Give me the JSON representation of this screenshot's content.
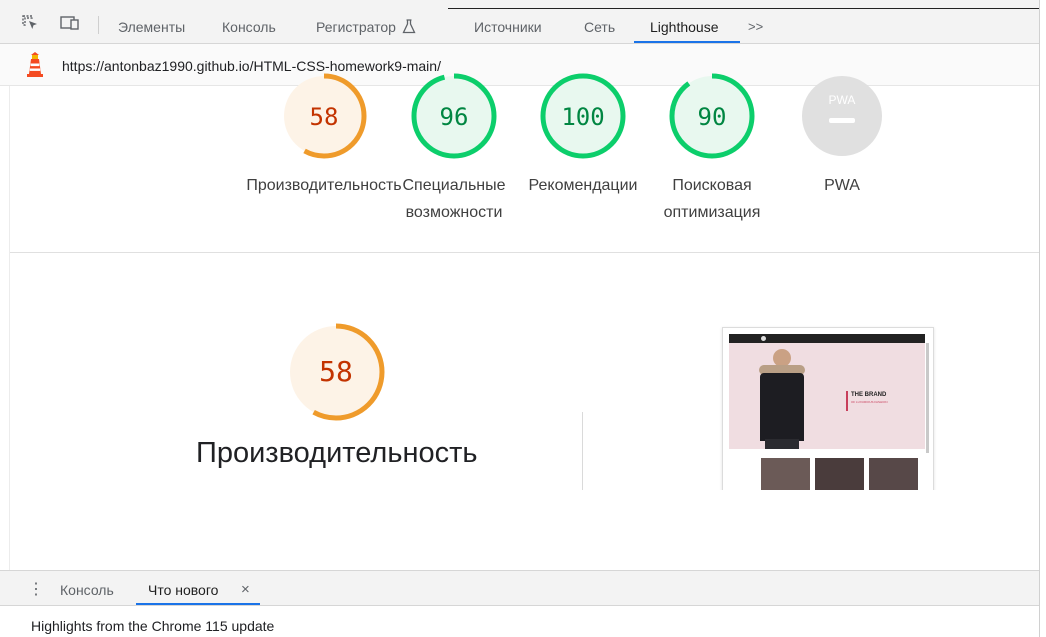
{
  "devtools": {
    "tabs": [
      {
        "label": "Элементы"
      },
      {
        "label": "Консоль"
      },
      {
        "label": "Регистратор"
      },
      {
        "label": "Источники"
      },
      {
        "label": "Сеть"
      },
      {
        "label": "Lighthouse",
        "active": true
      }
    ],
    "overflow_label": ">>"
  },
  "report": {
    "url": "https://antonbaz1990.github.io/HTML-CSS-homework9-main/",
    "categories": [
      {
        "score": "58",
        "label_lines": [
          "Производительность"
        ],
        "rating": "average",
        "fraction": 0.58
      },
      {
        "score": "96",
        "label_lines": [
          "Специальные",
          "возможности"
        ],
        "rating": "pass",
        "fraction": 0.96
      },
      {
        "score": "100",
        "label_lines": [
          "Рекомендации"
        ],
        "rating": "pass",
        "fraction": 1.0
      },
      {
        "score": "90",
        "label_lines": [
          "Поисковая",
          "оптимизация"
        ],
        "rating": "pass",
        "fraction": 0.9
      },
      {
        "score": "",
        "badge": "PWA",
        "label_lines": [
          "PWA"
        ],
        "rating": "na",
        "fraction": 0
      }
    ],
    "perf": {
      "score": "58",
      "title": "Производительность",
      "fraction": 0.58
    },
    "screenshot": {
      "brand_title": "THE BRAND",
      "brand_sub": "OF LUXURIOUS FASHION"
    }
  },
  "drawer": {
    "tabs": [
      {
        "label": "Консоль"
      },
      {
        "label": "Что нового",
        "active": true
      }
    ],
    "close_glyph": "×",
    "content": "Highlights from the Chrome 115 update"
  },
  "colors": {
    "average": "#ef9b2b",
    "average_bg": "#fdf3e7",
    "average_text": "#c33300",
    "pass": "#0cce6b",
    "pass_bg": "#e8f8ef",
    "pass_text": "#018642",
    "na": "#e0e0e0",
    "accent": "#1a73e8"
  }
}
